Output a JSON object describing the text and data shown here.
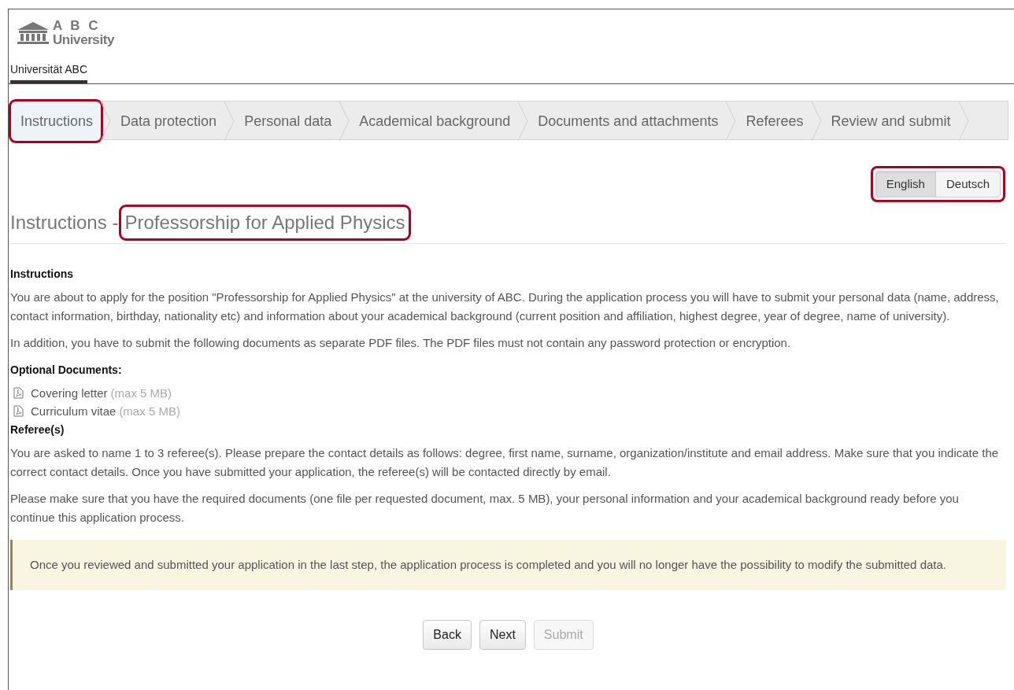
{
  "logo": {
    "line1": "A B C",
    "line2": "University"
  },
  "nav": {
    "label": "Universität ABC",
    "selected": true
  },
  "steps": [
    {
      "label": "Instructions",
      "selected": true,
      "highlighted": true
    },
    {
      "label": "Data protection",
      "selected": false,
      "highlighted": false
    },
    {
      "label": "Personal data",
      "selected": false,
      "highlighted": false
    },
    {
      "label": "Academical background",
      "selected": false,
      "highlighted": false
    },
    {
      "label": "Documents and attachments",
      "selected": false,
      "highlighted": false
    },
    {
      "label": "Referees",
      "selected": false,
      "highlighted": false
    },
    {
      "label": "Review and submit",
      "selected": false,
      "highlighted": false
    }
  ],
  "languages": {
    "highlighted": true,
    "options": [
      {
        "label": "English",
        "selected": true
      },
      {
        "label": "Deutsch",
        "selected": false
      }
    ]
  },
  "title": {
    "prefix": "Instructions -",
    "subject": "Professorship for Applied Physics",
    "highlighted": true
  },
  "sections": [
    {
      "kind": "heading",
      "text": "Instructions"
    },
    {
      "kind": "paragraph",
      "text": "You are about to apply for the position \"Professorship for Applied Physics\" at the university of ABC. During the application process you will have to submit your personal data (name, address, contact information, birthday, nationality etc) and information about your academical background (current position and affiliation, highest degree, year of degree, name of university)."
    },
    {
      "kind": "paragraph",
      "text": "In addition, you have to submit the following documents as separate PDF files. The PDF files must not contain any password protection or encryption."
    },
    {
      "kind": "heading",
      "text": "Optional Documents:"
    },
    {
      "kind": "document",
      "name": "Covering letter",
      "limit": "(max 5 MB)"
    },
    {
      "kind": "document",
      "name": "Curriculum vitae",
      "limit": "(max 5 MB)"
    },
    {
      "kind": "heading",
      "text": "Referee(s)"
    },
    {
      "kind": "paragraph",
      "text": "You are asked to name 1 to 3 referee(s). Please prepare the contact details as follows: degree, first name, surname, organization/institute and email address. Make sure that you indicate the correct contact details. Once you have submitted your application, the referee(s) will be contacted directly by email."
    },
    {
      "kind": "paragraph",
      "text": "Please make sure that you have the required documents (one file per requested document, max. 5 MB), your personal information and your academical background ready before you continue this application process."
    }
  ],
  "notice": "Once you reviewed and submitted your application in the last step, the application process is completed and you will no longer have the possibility to modify the submitted data.",
  "buttons": [
    {
      "label": "Back",
      "disabled": false
    },
    {
      "label": "Next",
      "disabled": false
    },
    {
      "label": "Submit",
      "disabled": true
    }
  ]
}
